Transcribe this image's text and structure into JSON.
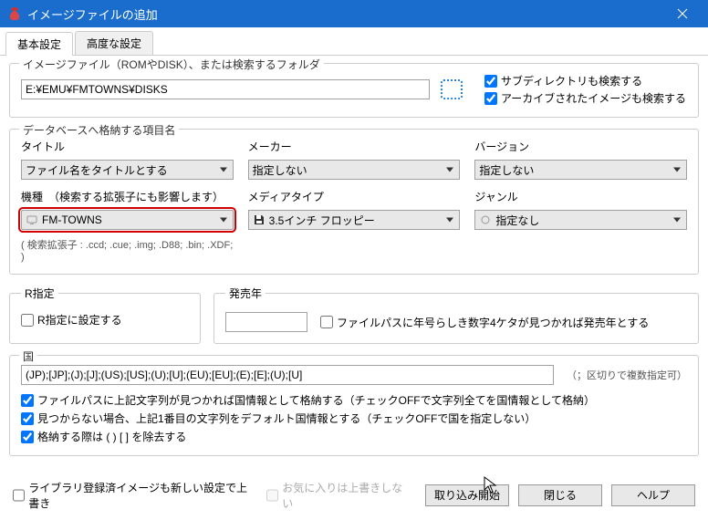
{
  "window": {
    "title": "イメージファイルの追加"
  },
  "tabs": {
    "basic": "基本設定",
    "advanced": "高度な設定"
  },
  "group_folder": {
    "legend": "イメージファイル（ROMやDISK）、または検索するフォルダ",
    "path": "E:¥EMU¥FMTOWNS¥DISKS",
    "cb_subdir": "サブディレクトリも検索する",
    "cb_archive": "アーカイブされたイメージも検索する"
  },
  "group_fields": {
    "legend": "データベースへ格納する項目名",
    "title_label": "タイトル",
    "title_value": "ファイル名をタイトルとする",
    "maker_label": "メーカー",
    "maker_value": "指定しない",
    "version_label": "バージョン",
    "version_value": "指定しない",
    "system_label": "機種　（検索する拡張子にも影響します）",
    "system_value": "FM-TOWNS",
    "media_label": "メディアタイプ",
    "media_value": "3.5インチ フロッピー",
    "genre_label": "ジャンル",
    "genre_value": "指定なし",
    "ext_hint": "( 検索拡張子 :   .ccd; .cue; .img; .D88; .bin; .XDF; )"
  },
  "r_group": {
    "legend": "R指定",
    "cb": "R指定に設定する"
  },
  "year_group": {
    "legend": "発売年",
    "value": "",
    "cb": "ファイルパスに年号らしき数字4ケタが見つかれば発売年とする"
  },
  "country_group": {
    "legend": "国",
    "value": "(JP);[JP];(J);[J];(US);[US];(U);[U];(EU);[EU];(E);[E];(U);[U]",
    "hint": "（；区切りで複数指定可）",
    "cb1": "ファイルパスに上記文字列が見つかれば国情報として格納する（チェックOFFで文字列全てを国情報として格納）",
    "cb2": "見つからない場合、上記1番目の文字列をデフォルト国情報とする（チェックOFFで国を指定しない）",
    "cb3": "格納する際は ( ) [ ] を除去する"
  },
  "footer": {
    "cb_lib": "ライブラリ登録済イメージも新しい設定で上書き",
    "cb_fav": "お気に入りは上書きしない",
    "btn_start": "取り込み開始",
    "btn_close": "閉じる",
    "btn_help": "ヘルプ"
  }
}
